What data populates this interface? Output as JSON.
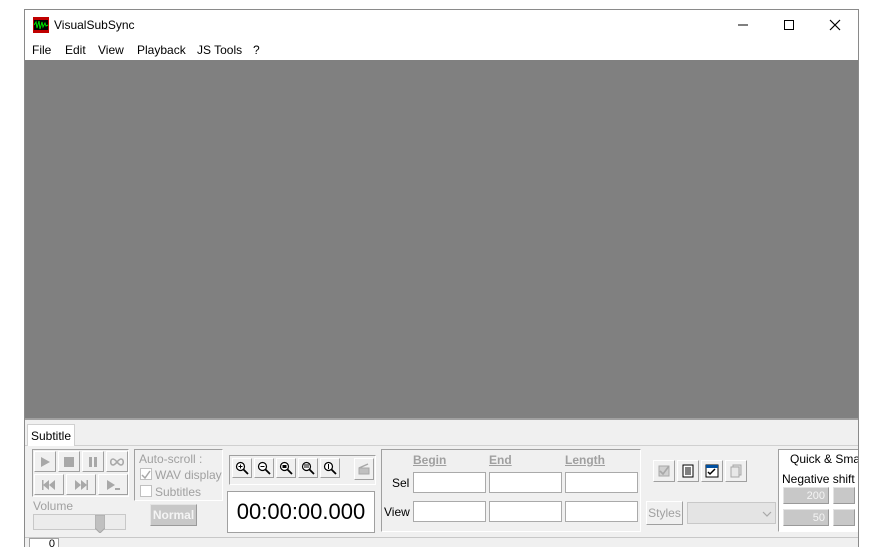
{
  "window": {
    "title": "VisualSubSync"
  },
  "menu": {
    "items": [
      "File",
      "Edit",
      "View",
      "Playback",
      "JS Tools",
      "?"
    ]
  },
  "tabs": {
    "subtitle": "Subtitle"
  },
  "playback": {
    "volume_label": "Volume",
    "normal_label": "Normal"
  },
  "autoscroll": {
    "label": "Auto-scroll :",
    "wav_display": "WAV display",
    "subtitles": "Subtitles",
    "wav_checked": true,
    "subtitles_checked": false
  },
  "time": {
    "display": "00:00:00.000"
  },
  "selection": {
    "begin": "Begin",
    "end": "End",
    "length": "Length",
    "sel": "Sel",
    "view": "View"
  },
  "styles": {
    "label": "Styles"
  },
  "quick": {
    "title": "Quick & Smar",
    "negative_shift": "Negative shift c",
    "value1": "200",
    "value2": "50"
  },
  "status": {
    "value": "0"
  },
  "colors": {
    "waveform": "#808080",
    "accent": "#0078d7"
  }
}
